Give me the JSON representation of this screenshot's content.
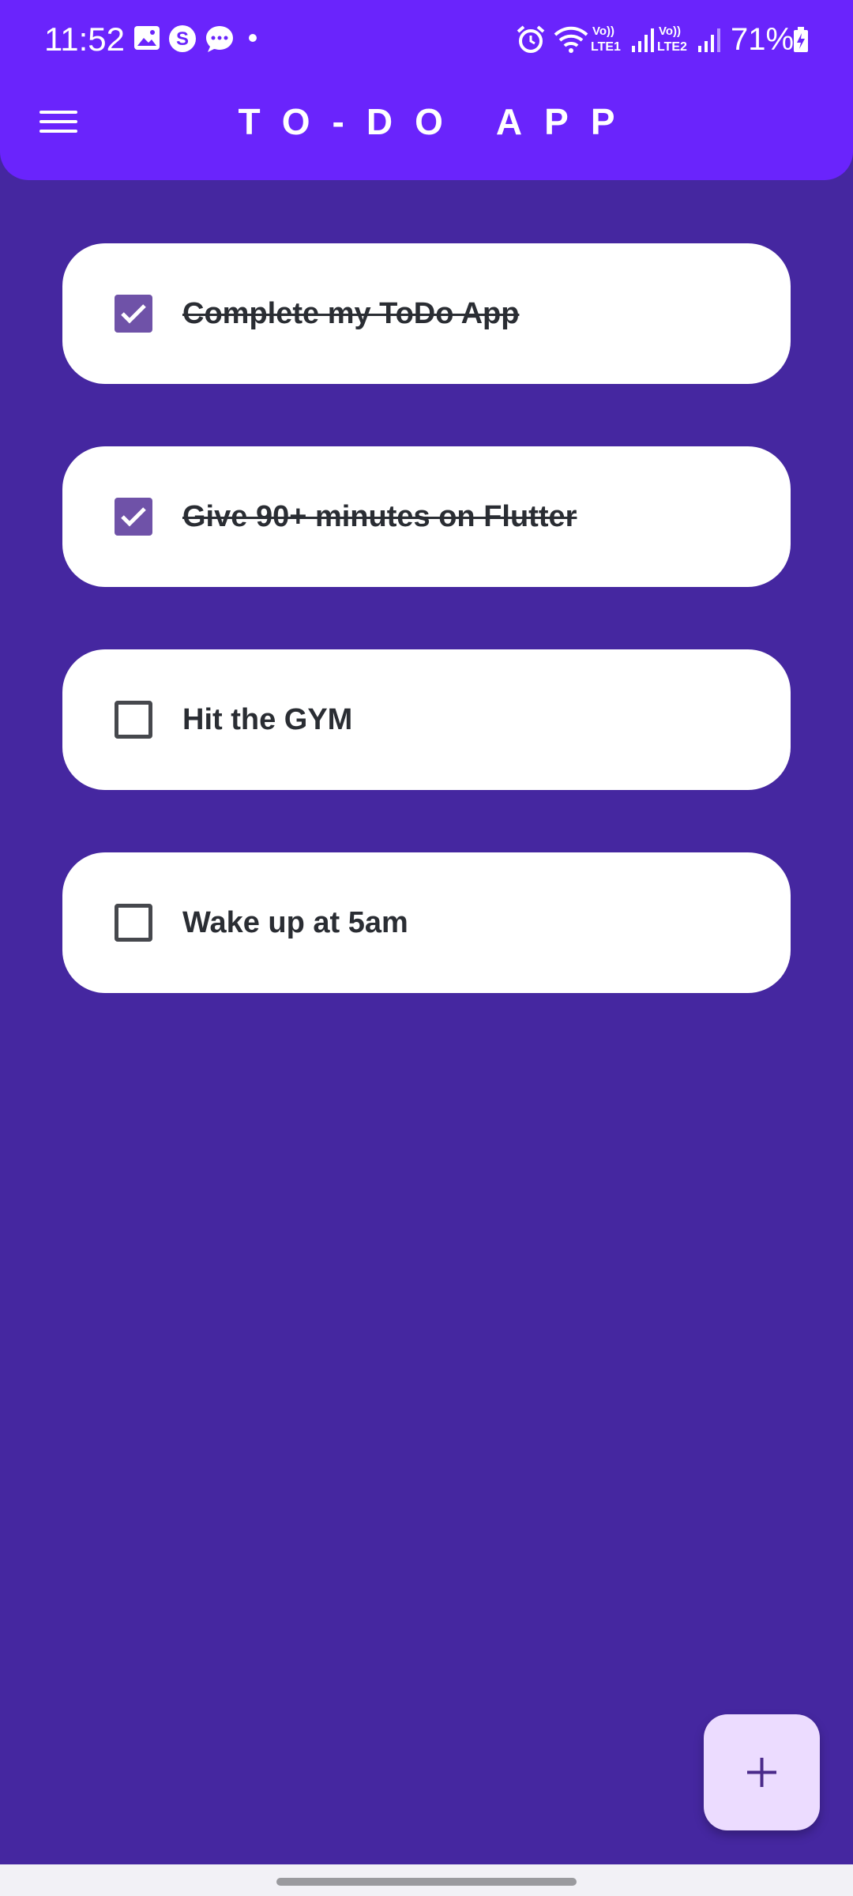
{
  "status_bar": {
    "time": "11:52",
    "battery": "71%",
    "icons": [
      "gallery-icon",
      "s-app-icon",
      "chat-icon",
      "dot-icon",
      "alarm-icon",
      "wifi-icon",
      "lte1-signal-icon",
      "lte2-signal-icon",
      "battery-charging-icon"
    ]
  },
  "app_bar": {
    "title": "TO-DO APP",
    "menu_icon": "hamburger-menu-icon"
  },
  "tasks": [
    {
      "text": "Complete my ToDo App",
      "done": true
    },
    {
      "text": "Give 90+ minutes on Flutter",
      "done": true
    },
    {
      "text": "Hit the GYM",
      "done": false
    },
    {
      "text": "Wake up at 5am",
      "done": false
    }
  ],
  "fab": {
    "icon": "plus-icon"
  },
  "colors": {
    "app_bar": "#6a24fc",
    "background": "#4527a0",
    "checkbox_checked": "#6f52a8",
    "fab_background": "#ecdcff",
    "fab_icon": "#4a2a8a"
  }
}
